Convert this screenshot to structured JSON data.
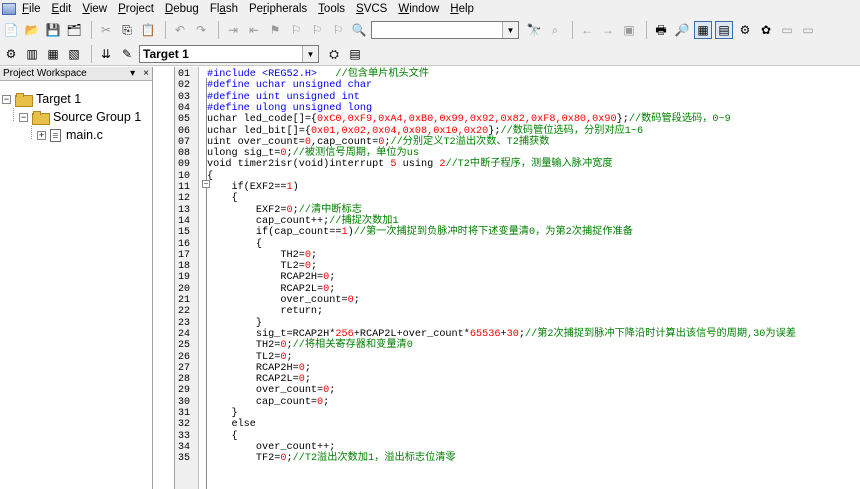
{
  "menu": {
    "items": [
      {
        "label": "File",
        "u": "F"
      },
      {
        "label": "Edit",
        "u": "E"
      },
      {
        "label": "View",
        "u": "V"
      },
      {
        "label": "Project",
        "u": "P"
      },
      {
        "label": "Debug",
        "u": "D"
      },
      {
        "label": "Flash",
        "u": "a"
      },
      {
        "label": "Peripherals",
        "u": "r"
      },
      {
        "label": "Tools",
        "u": "T"
      },
      {
        "label": "SVCS",
        "u": "S"
      },
      {
        "label": "Window",
        "u": "W"
      },
      {
        "label": "Help",
        "u": "H"
      }
    ]
  },
  "toolbar": {
    "search_value": "",
    "target_select": "Target 1"
  },
  "workspace": {
    "title": "Project Workspace",
    "pin_glyph": "▾",
    "close_glyph": "×",
    "tree": {
      "root": "Target 1",
      "group": "Source Group 1",
      "file": "main.c"
    }
  },
  "colors": {
    "keyword": "#0000ff",
    "comment": "#008000",
    "number": "#ff0000"
  },
  "editor": {
    "lines": [
      {
        "n": "01",
        "t": [
          [
            "pp",
            "#include <REG52.H>"
          ],
          [
            "tx",
            "   "
          ],
          [
            "cm",
            "//包含单片机头文件"
          ]
        ]
      },
      {
        "n": "02",
        "t": [
          [
            "pp",
            "#define uchar unsigned char"
          ]
        ]
      },
      {
        "n": "03",
        "t": [
          [
            "pp",
            "#define uint unsigned int"
          ]
        ]
      },
      {
        "n": "04",
        "t": [
          [
            "pp",
            "#define ulong unsigned long"
          ]
        ]
      },
      {
        "n": "05",
        "t": [
          [
            "tx",
            "uchar led_code[]={"
          ],
          [
            "nm",
            "0xC0,0xF9,0xA4,0xB0,0x99,0x92,0x82,0xF8,0x80,0x90"
          ],
          [
            "tx",
            "};"
          ],
          [
            "cm",
            "//数码管段选码，0~9"
          ]
        ]
      },
      {
        "n": "06",
        "t": [
          [
            "tx",
            "uchar led_bit[]={"
          ],
          [
            "nm",
            "0x01,0x02,0x04,0x08,0x10,0x20"
          ],
          [
            "tx",
            "};"
          ],
          [
            "cm",
            "//数码管位选码，分别对应1~6"
          ]
        ]
      },
      {
        "n": "07",
        "t": [
          [
            "tx",
            "uint over_count="
          ],
          [
            "nm",
            "0"
          ],
          [
            "tx",
            ",cap_count="
          ],
          [
            "nm",
            "0"
          ],
          [
            "tx",
            ";"
          ],
          [
            "cm",
            "//分别定义T2溢出次数、T2捕获数"
          ]
        ]
      },
      {
        "n": "08",
        "t": [
          [
            "tx",
            "ulong sig_t="
          ],
          [
            "nm",
            "0"
          ],
          [
            "tx",
            ";"
          ],
          [
            "cm",
            "//被测信号周期，单位为us"
          ]
        ]
      },
      {
        "n": "09",
        "t": [
          [
            "tx",
            "void timer2isr(void)interrupt "
          ],
          [
            "nm",
            "5"
          ],
          [
            "tx",
            " using "
          ],
          [
            "nm",
            "2"
          ],
          [
            "cm",
            "//T2中断子程序，测量输入脉冲宽度"
          ]
        ]
      },
      {
        "n": "10",
        "t": [
          [
            "tx",
            "{"
          ]
        ]
      },
      {
        "n": "11",
        "t": [
          [
            "tx",
            "    if(EXF2=="
          ],
          [
            "nm",
            "1"
          ],
          [
            "tx",
            ")"
          ]
        ]
      },
      {
        "n": "12",
        "t": [
          [
            "tx",
            "    {"
          ]
        ]
      },
      {
        "n": "13",
        "t": [
          [
            "tx",
            "        EXF2="
          ],
          [
            "nm",
            "0"
          ],
          [
            "tx",
            ";"
          ],
          [
            "cm",
            "//清中断标志"
          ]
        ]
      },
      {
        "n": "14",
        "t": [
          [
            "tx",
            "        cap_count++;"
          ],
          [
            "cm",
            "//捕捉次数加1"
          ]
        ]
      },
      {
        "n": "15",
        "t": [
          [
            "tx",
            "        if(cap_count=="
          ],
          [
            "nm",
            "1"
          ],
          [
            "tx",
            ")"
          ],
          [
            "cm",
            "//第一次捕捉到负脉冲时将下述变量清0，为第2次捕捉作准备"
          ]
        ]
      },
      {
        "n": "16",
        "t": [
          [
            "tx",
            "        {"
          ]
        ]
      },
      {
        "n": "17",
        "t": [
          [
            "tx",
            "            TH2="
          ],
          [
            "nm",
            "0"
          ],
          [
            "tx",
            ";"
          ]
        ]
      },
      {
        "n": "18",
        "t": [
          [
            "tx",
            "            TL2="
          ],
          [
            "nm",
            "0"
          ],
          [
            "tx",
            ";"
          ]
        ]
      },
      {
        "n": "19",
        "t": [
          [
            "tx",
            "            RCAP2H="
          ],
          [
            "nm",
            "0"
          ],
          [
            "tx",
            ";"
          ]
        ]
      },
      {
        "n": "20",
        "t": [
          [
            "tx",
            "            RCAP2L="
          ],
          [
            "nm",
            "0"
          ],
          [
            "tx",
            ";"
          ]
        ]
      },
      {
        "n": "21",
        "t": [
          [
            "tx",
            "            over_count="
          ],
          [
            "nm",
            "0"
          ],
          [
            "tx",
            ";"
          ]
        ]
      },
      {
        "n": "22",
        "t": [
          [
            "tx",
            "            return;"
          ]
        ]
      },
      {
        "n": "23",
        "t": [
          [
            "tx",
            "        }"
          ]
        ]
      },
      {
        "n": "24",
        "t": [
          [
            "tx",
            "        sig_t=RCAP2H*"
          ],
          [
            "nm",
            "256"
          ],
          [
            "tx",
            "+RCAP2L+over_count*"
          ],
          [
            "nm",
            "65536"
          ],
          [
            "tx",
            "+"
          ],
          [
            "nm",
            "30"
          ],
          [
            "tx",
            ";"
          ],
          [
            "cm",
            "//第2次捕捉到脉冲下降沿时计算出该信号的周期,30为误差"
          ]
        ]
      },
      {
        "n": "25",
        "t": [
          [
            "tx",
            "        TH2="
          ],
          [
            "nm",
            "0"
          ],
          [
            "tx",
            ";"
          ],
          [
            "cm",
            "//将相关寄存器和变量清0"
          ]
        ]
      },
      {
        "n": "26",
        "t": [
          [
            "tx",
            "        TL2="
          ],
          [
            "nm",
            "0"
          ],
          [
            "tx",
            ";"
          ]
        ]
      },
      {
        "n": "27",
        "t": [
          [
            "tx",
            "        RCAP2H="
          ],
          [
            "nm",
            "0"
          ],
          [
            "tx",
            ";"
          ]
        ]
      },
      {
        "n": "28",
        "t": [
          [
            "tx",
            "        RCAP2L="
          ],
          [
            "nm",
            "0"
          ],
          [
            "tx",
            ";"
          ]
        ]
      },
      {
        "n": "29",
        "t": [
          [
            "tx",
            "        over_count="
          ],
          [
            "nm",
            "0"
          ],
          [
            "tx",
            ";"
          ]
        ]
      },
      {
        "n": "30",
        "t": [
          [
            "tx",
            "        cap_count="
          ],
          [
            "nm",
            "0"
          ],
          [
            "tx",
            ";"
          ]
        ]
      },
      {
        "n": "31",
        "t": [
          [
            "tx",
            "    }"
          ]
        ]
      },
      {
        "n": "32",
        "t": [
          [
            "tx",
            "    else"
          ]
        ]
      },
      {
        "n": "33",
        "t": [
          [
            "tx",
            "    {"
          ]
        ]
      },
      {
        "n": "34",
        "t": [
          [
            "tx",
            "        over_count++;"
          ]
        ]
      },
      {
        "n": "35",
        "t": [
          [
            "tx",
            "        TF2="
          ],
          [
            "nm",
            "0"
          ],
          [
            "tx",
            ";"
          ],
          [
            "cm",
            "//T2溢出次数加1，溢出标志位清零"
          ]
        ]
      }
    ]
  }
}
